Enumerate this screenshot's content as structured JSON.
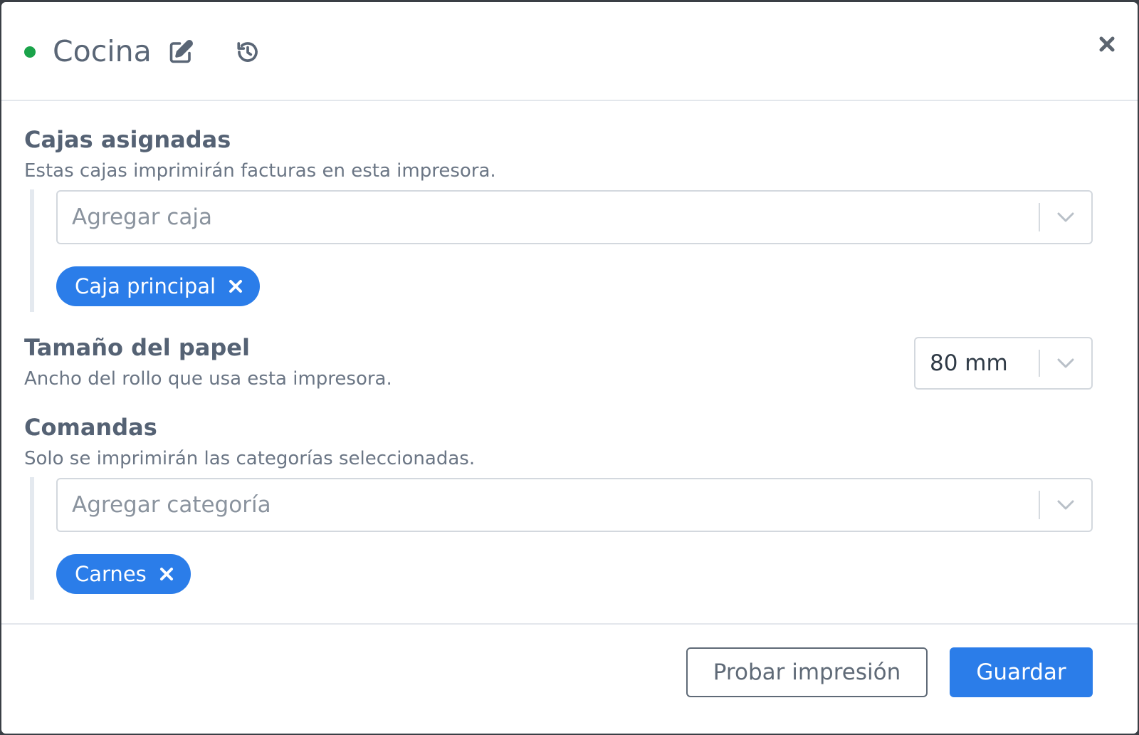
{
  "colors": {
    "status_dot": "#1aa34a",
    "accent": "#2b7de9",
    "chip_bg": "#2b7de9"
  },
  "header": {
    "title": "Cocina",
    "edit_icon": "edit-icon",
    "history_icon": "history-icon",
    "close_icon": "close-icon"
  },
  "cajas": {
    "title": "Cajas asignadas",
    "description": "Estas cajas imprimirán facturas en esta impresora.",
    "placeholder": "Agregar caja",
    "chips": [
      {
        "label": "Caja principal"
      }
    ]
  },
  "papel": {
    "title": "Tamaño del papel",
    "description": "Ancho del rollo que usa esta impresora.",
    "selected": "80 mm"
  },
  "comandas": {
    "title": "Comandas",
    "description": "Solo se imprimirán las categorías seleccionadas.",
    "placeholder": "Agregar categoría",
    "chips": [
      {
        "label": "Carnes"
      }
    ]
  },
  "footer": {
    "test_print_label": "Probar impresión",
    "save_label": "Guardar"
  }
}
